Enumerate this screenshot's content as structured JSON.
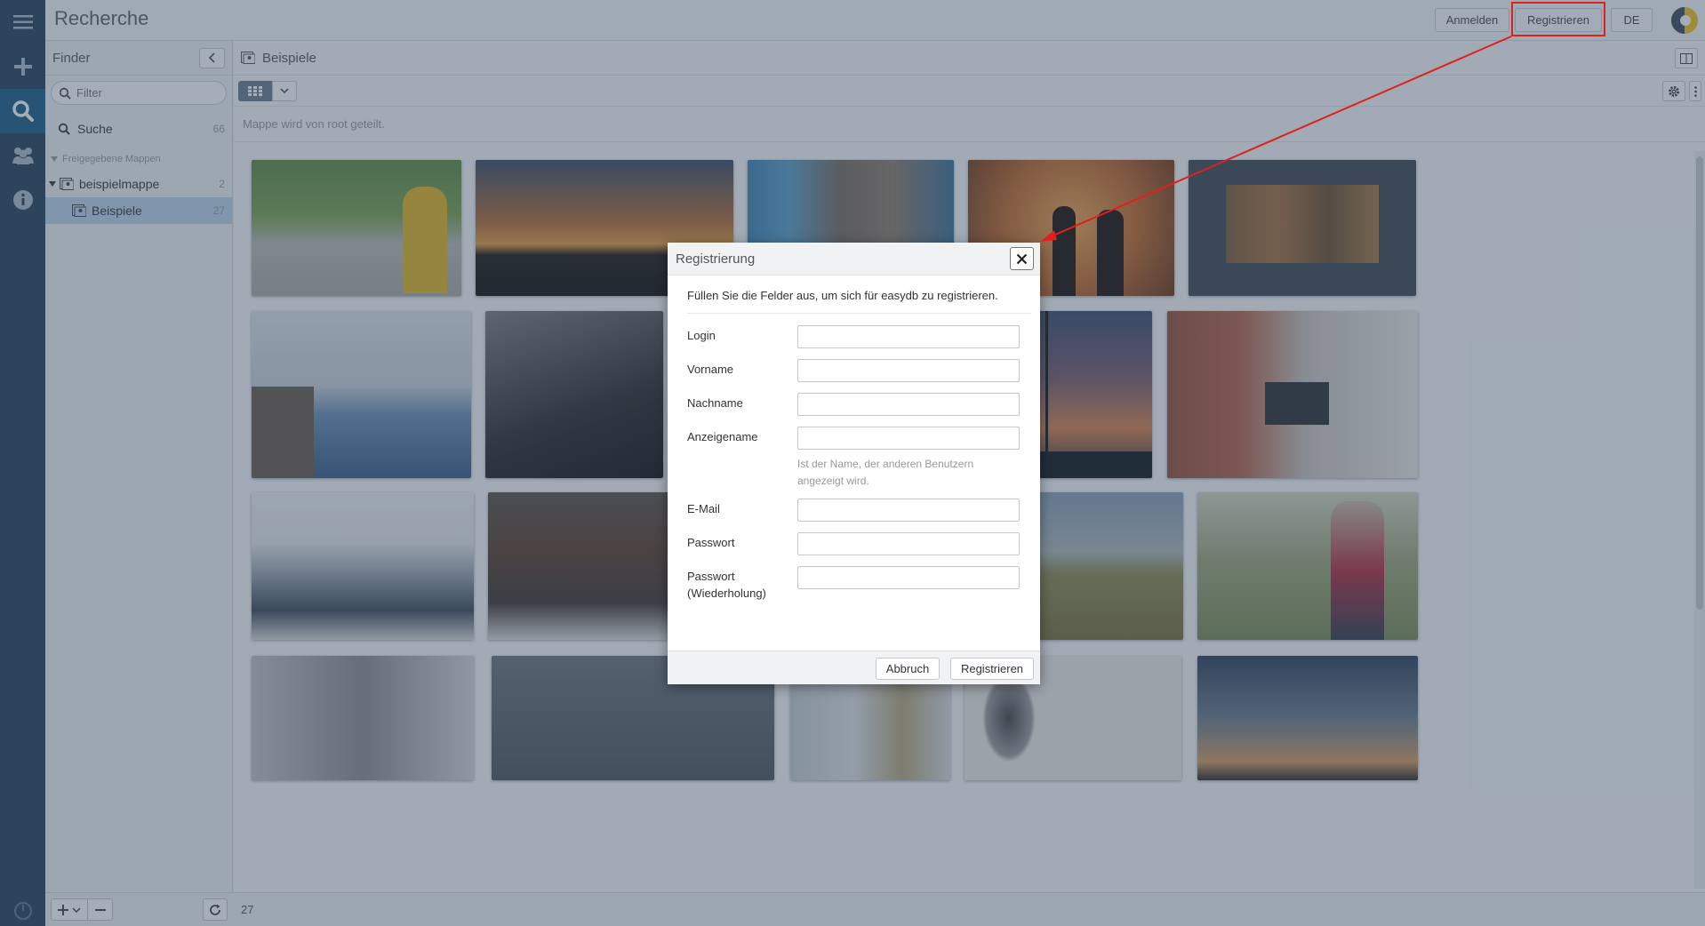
{
  "app": {
    "title": "Recherche"
  },
  "topbar": {
    "login_label": "Anmelden",
    "register_label": "Registrieren",
    "lang_label": "DE"
  },
  "sidebar": {
    "title": "Finder",
    "filter_placeholder": "Filter",
    "search": {
      "label": "Suche",
      "count": "66"
    },
    "section_label": "Freigegebene Mappen",
    "folders": [
      {
        "label": "beispielmappe",
        "count": "2"
      },
      {
        "label": "Beispiele",
        "count": "27"
      }
    ]
  },
  "main": {
    "title": "Beispiele",
    "share_note": "Mappe wird von root geteilt.",
    "count": "27"
  },
  "modal": {
    "title": "Registrierung",
    "intro": "Füllen Sie die Felder aus, um sich für easydb zu registrieren.",
    "fields": {
      "login": "Login",
      "vorname": "Vorname",
      "nachname": "Nachname",
      "anzeigename": "Anzeigename",
      "anzeigename_hint": "Ist der Name, der anderen Benutzern angezeigt wird.",
      "email": "E-Mail",
      "passwort": "Passwort",
      "passwort2": "Passwort (Wiederholung)"
    },
    "cancel_label": "Abbruch",
    "register_label": "Registrieren"
  },
  "colors": {
    "annotation": "#e0201d",
    "rail": "#24405a",
    "selection": "#bcd4ea"
  }
}
